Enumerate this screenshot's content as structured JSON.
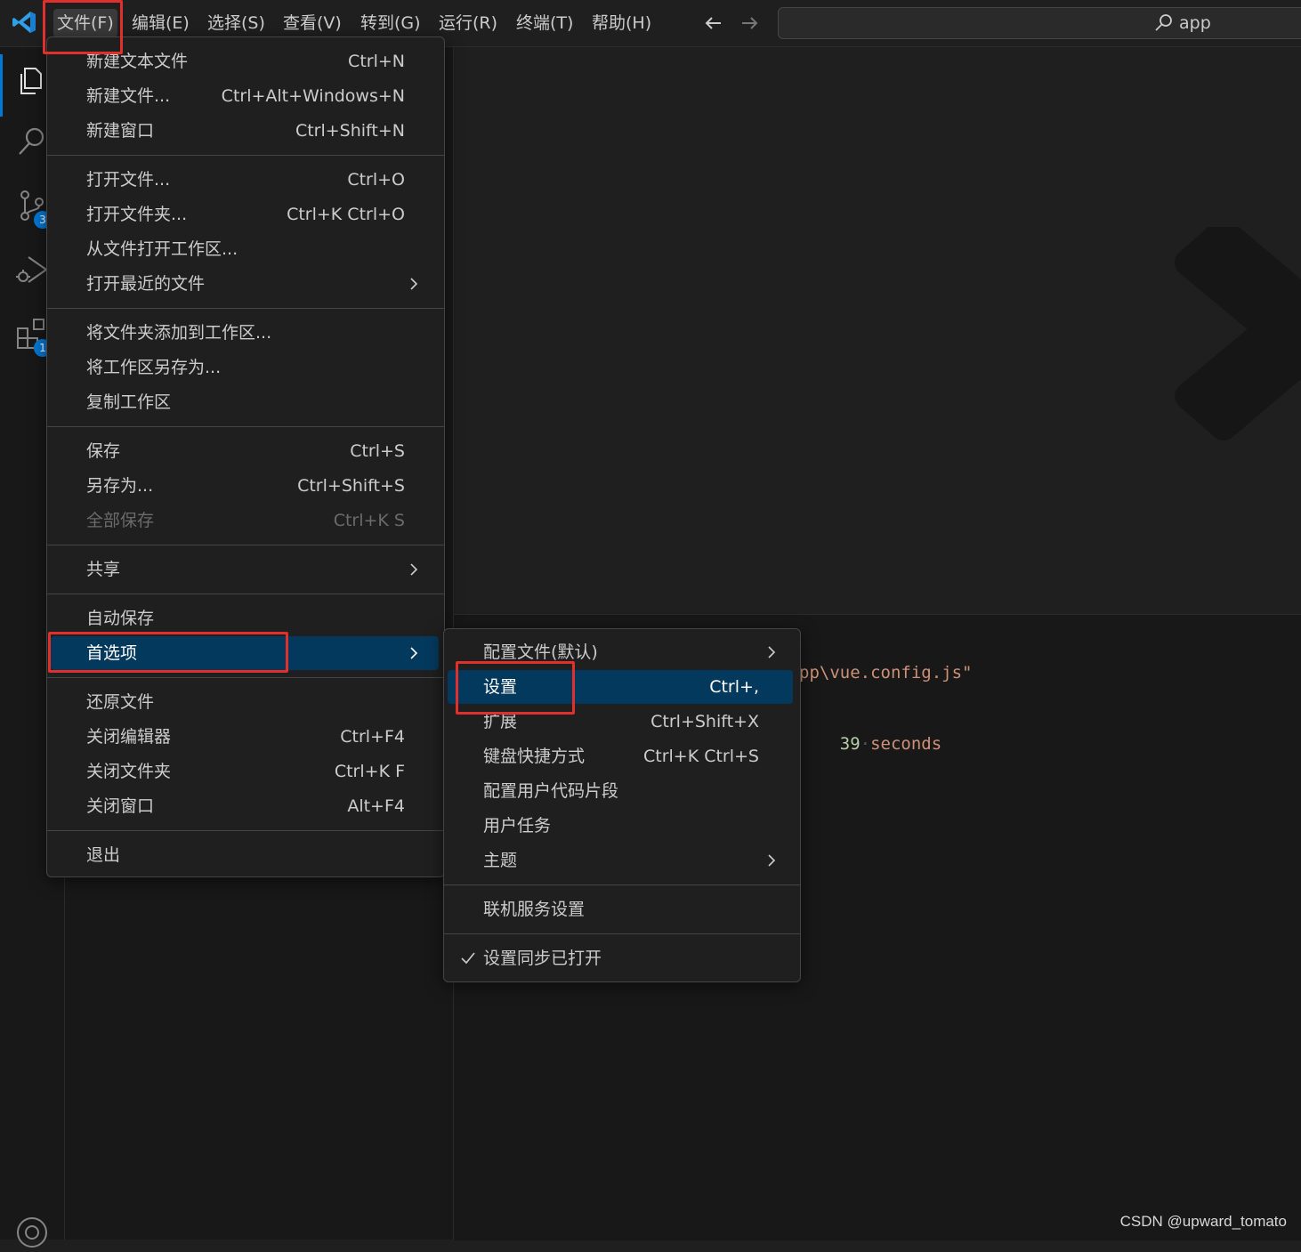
{
  "menubar": {
    "items": [
      "文件(F)",
      "编辑(E)",
      "选择(S)",
      "查看(V)",
      "转到(G)",
      "运行(R)",
      "终端(T)",
      "帮助(H)"
    ],
    "command_center_text": "app"
  },
  "activity_badges": {
    "source_control": "3",
    "extensions": "1"
  },
  "file_menu": {
    "items": [
      {
        "label": "新建文本文件",
        "kb": "Ctrl+N"
      },
      {
        "label": "新建文件...",
        "kb": "Ctrl+Alt+Windows+N"
      },
      {
        "label": "新建窗口",
        "kb": "Ctrl+Shift+N"
      },
      {
        "label": "打开文件...",
        "kb": "Ctrl+O"
      },
      {
        "label": "打开文件夹...",
        "kb": "Ctrl+K Ctrl+O"
      },
      {
        "label": "从文件打开工作区..."
      },
      {
        "label": "打开最近的文件"
      },
      {
        "label": "将文件夹添加到工作区..."
      },
      {
        "label": "将工作区另存为..."
      },
      {
        "label": "复制工作区"
      },
      {
        "label": "保存",
        "kb": "Ctrl+S"
      },
      {
        "label": "另存为...",
        "kb": "Ctrl+Shift+S"
      },
      {
        "label": "全部保存",
        "kb": "Ctrl+K S"
      },
      {
        "label": "共享"
      },
      {
        "label": "自动保存"
      },
      {
        "label": "首选项"
      },
      {
        "label": "还原文件"
      },
      {
        "label": "关闭编辑器",
        "kb": "Ctrl+F4"
      },
      {
        "label": "关闭文件夹",
        "kb": "Ctrl+K F"
      },
      {
        "label": "关闭窗口",
        "kb": "Alt+F4"
      },
      {
        "label": "退出"
      }
    ]
  },
  "prefs_menu": {
    "items": [
      {
        "label": "配置文件(默认)"
      },
      {
        "label": "设置",
        "kb": "Ctrl+,"
      },
      {
        "label": "扩展",
        "kb": "Ctrl+Shift+X"
      },
      {
        "label": "键盘快捷方式",
        "kb": "Ctrl+K Ctrl+S"
      },
      {
        "label": "配置用户代码片段"
      },
      {
        "label": "用户任务"
      },
      {
        "label": "主题"
      },
      {
        "label": "联机服务设置"
      },
      {
        "label": "设置同步已打开"
      }
    ]
  },
  "terminal": {
    "line1": "pp\\vue.config.js\"",
    "line2_num": "39",
    "line2_text": "seconds"
  },
  "credit": "CSDN @upward_tomato",
  "colors": {
    "accent": "#0078d4",
    "selection": "#04395e",
    "highlight_box": "#e0302b"
  }
}
